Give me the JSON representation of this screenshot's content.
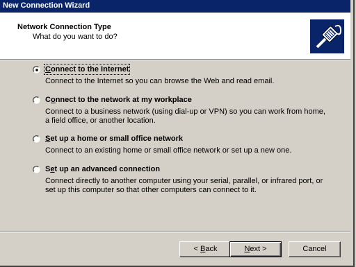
{
  "window": {
    "title": "New Connection Wizard"
  },
  "header": {
    "title": "Network Connection Type",
    "subtitle": "What do you want to do?",
    "icon": "network-cable-icon"
  },
  "options": [
    {
      "label_prefix": "",
      "label_mnemonic": "C",
      "label_rest": "onnect to the Internet",
      "description": [
        "Connect to the Internet so you can browse the Web and read email."
      ],
      "selected": true
    },
    {
      "label_prefix": "C",
      "label_mnemonic": "o",
      "label_rest": "nnect to the network at my workplace",
      "description": [
        "Connect to a business network (using dial-up or VPN) so you can work from home,",
        "a field office, or another location."
      ],
      "selected": false
    },
    {
      "label_prefix": "",
      "label_mnemonic": "S",
      "label_rest": "et up a home or small office network",
      "description": [
        "Connect to an existing home or small office network or set up a new one."
      ],
      "selected": false
    },
    {
      "label_prefix": "S",
      "label_mnemonic": "e",
      "label_rest": "t up an advanced connection",
      "description": [
        "Connect directly to another computer using your serial, parallel, or infrared port, or",
        "set up this computer so that other computers can connect to it."
      ],
      "selected": false
    }
  ],
  "buttons": {
    "back": {
      "prefix": "< ",
      "mnemonic": "B",
      "rest": "ack"
    },
    "next": {
      "prefix": "",
      "mnemonic": "N",
      "rest": "ext >"
    },
    "cancel": {
      "label": "Cancel"
    }
  }
}
